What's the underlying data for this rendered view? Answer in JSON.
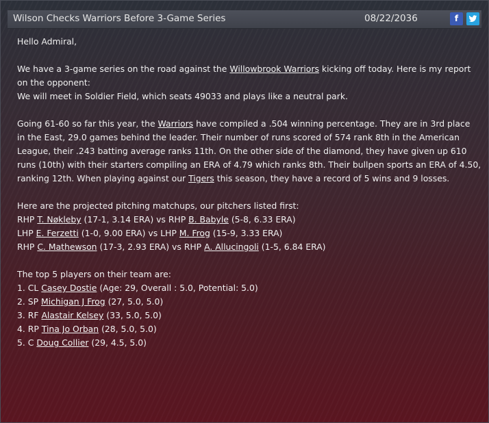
{
  "header": {
    "title": "Wilson Checks Warriors Before 3-Game Series",
    "date": "08/22/2036",
    "facebook_label": "f"
  },
  "body": {
    "greeting": "Hello Admiral,",
    "intro": {
      "before": "We have a 3-game series on the road against the ",
      "opponent_link": "Willowbrook Warriors",
      "after": " kicking off today. Here is my report",
      "line2": "on the opponent:",
      "line3": "We will meet in Soldier Field, which seats 49033 and plays like a neutral park."
    },
    "record": {
      "l1_before": "Going 61-60 so far this year, the ",
      "l1_link": "Warriors",
      "l1_after": " have compiled a .504 winning percentage. They are in 3rd place",
      "l2": "in the East, 29.0 games behind the leader. Their number of runs scored of 574 rank 8th in the American",
      "l3": "League, their .243 batting average ranks 11th. On the other side of the diamond, they have given up 610",
      "l4": "runs (10th) with their starters compiling an ERA of 4.79 which ranks 8th. Their bullpen sports an ERA of 4.50,",
      "l5_before": "ranking 12th. When playing against our ",
      "l5_link": "Tigers",
      "l5_after": " this season, they have a record of 5 wins and 9 losses."
    },
    "matchups_header": "Here are the projected pitching matchups, our pitchers listed first:",
    "matchups": [
      {
        "our_hand": "RHP ",
        "our_name": "T. Nøkleby",
        "our_stats": " (17-1, 3.14 ERA) vs RHP ",
        "opp_name": "B. Babyle",
        "opp_stats": " (5-8, 6.33 ERA)"
      },
      {
        "our_hand": "LHP ",
        "our_name": "E. Ferzetti",
        "our_stats": " (1-0, 9.00 ERA) vs LHP ",
        "opp_name": "M. Frog",
        "opp_stats": " (15-9, 3.33 ERA)"
      },
      {
        "our_hand": "RHP ",
        "our_name": "C. Mathewson",
        "our_stats": " (17-3, 2.93 ERA) vs RHP ",
        "opp_name": "A. Allucingoli",
        "opp_stats": " (1-5, 6.84 ERA)"
      }
    ],
    "top_players_header": "The top 5 players on their team are:",
    "top_players": [
      {
        "prefix": "1. CL ",
        "name": "Casey Dostie",
        "details": " (Age: 29, Overall : 5.0, Potential: 5.0)"
      },
      {
        "prefix": "2. SP ",
        "name": "Michigan J Frog",
        "details": " (27, 5.0, 5.0)"
      },
      {
        "prefix": "3. RF ",
        "name": "Alastair Kelsey",
        "details": " (33, 5.0, 5.0)"
      },
      {
        "prefix": "4. RP ",
        "name": "Tina Jo Orban",
        "details": " (28, 5.0, 5.0)"
      },
      {
        "prefix": "5. C ",
        "name": "Doug Collier",
        "details": " (29, 4.5, 5.0)"
      }
    ]
  },
  "colors": {
    "title_bar": "#454852",
    "facebook": "#3b5bb5",
    "twitter": "#29a3e0",
    "text": "#f0f0f0"
  },
  "icons": [
    "facebook-icon",
    "twitter-icon"
  ]
}
